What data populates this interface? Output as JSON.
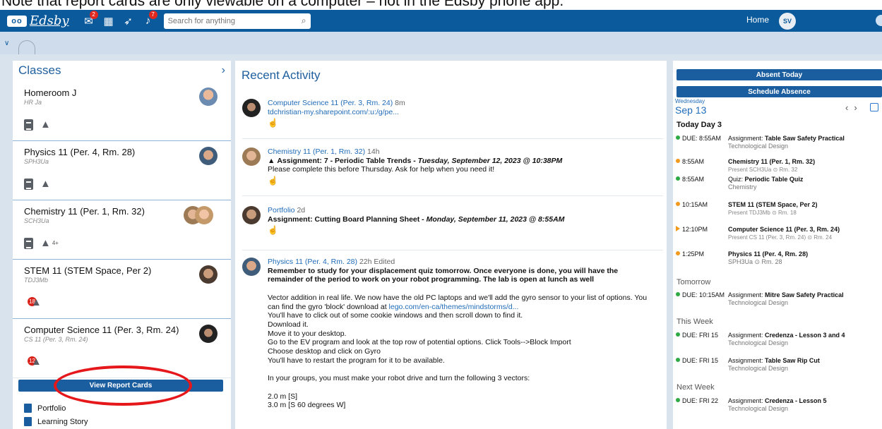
{
  "caption": "Note that report cards are only viewable on a computer – not in the Edsby phone app.",
  "colors": {
    "brand": "#0b5a9c",
    "accent_red": "#e5171a",
    "due_green": "#2eaa44",
    "event_orange": "#f39a1d"
  },
  "topbar": {
    "logo_mark": "oo",
    "logo_text": "Edsby",
    "mail_badge": "2",
    "bell_badge": "7",
    "search_placeholder": "Search for anything",
    "home": "Home",
    "avatar": "SV"
  },
  "classes": {
    "title": "Classes",
    "items": [
      {
        "name": "Homeroom J",
        "code": "HR Ja",
        "badge": "",
        "extra": ""
      },
      {
        "name": "Physics 11 (Per. 4, Rm. 28)",
        "code": "SPH3Ua",
        "badge": "",
        "extra": ""
      },
      {
        "name": "Chemistry 11 (Per. 1, Rm. 32)",
        "code": "SCH3Ua",
        "badge": "",
        "extra": "4+"
      },
      {
        "name": "STEM 11 (STEM Space, Per 2)",
        "code": "TDJ3Mb",
        "badge": "18",
        "extra": ""
      },
      {
        "name": "Computer Science 11 (Per. 3, Rm. 24)",
        "code": "CS 11 (Per. 3, Rm. 24)",
        "badge": "12",
        "extra": ""
      }
    ],
    "report_button": "View Report Cards",
    "links": [
      "Portfolio",
      "Learning Story"
    ]
  },
  "activity": {
    "title": "Recent Activity",
    "items": [
      {
        "source": "Computer Science 11 (Per. 3, Rm. 24)",
        "time": "8m",
        "link": "tdchristian-my.sharepoint.com/:u:/g/pe..."
      },
      {
        "source": "Chemistry 11 (Per. 1, Rm. 32)",
        "time": "14h",
        "label": "Assignment: 7 - Periodic Table Trends",
        "date": " - Tuesday, September 12, 2023 @ 10:38PM",
        "text": "Please complete this before Thursday. Ask for help when you need it!"
      },
      {
        "source": "Portfolio",
        "time": "2d",
        "label": "Assignment: Cutting Board Planning Sheet",
        "date": " - Monday, September 11, 2023 @ 8:55AM"
      },
      {
        "source": "Physics 11 (Per. 4, Rm. 28)",
        "time": "22h",
        "edited": "Edited",
        "bold1": "Remember to study for your displacement quiz tomorrow. Once everyone is done, you will have the",
        "bold2": "remainder of the period to work on your robot programming. The lab is open at lunch as well",
        "p1": "Vector addition in real life. We now have the old PC laptops and we'll add the gyro sensor to your list of options. You",
        "p2a": "can find the gyro 'block' download at ",
        "p2link": "lego.com/en-ca/themes/mindstorms/d...",
        "p3": "You'll have to click out of some cookie windows and then scroll down to find it.",
        "p4": "Download it.",
        "p5": "Move it to your desktop.",
        "p6": "Go to the EV program and look at the top row of potential options. Click Tools-->Block Import",
        "p7": "Choose desktop and click on Gyro",
        "p8": "You'll have to restart the program for it to be available.",
        "p9": "In your groups, you must make your robot drive and turn the following 3 vectors:",
        "p10": "2.0 m [S]",
        "p11": "3.0 m [S 60 degrees W]"
      }
    ]
  },
  "schedule": {
    "absent_today": "Absent Today",
    "schedule_absence": "Schedule Absence",
    "weekday": "Wednesday",
    "date": "Sep 13",
    "today_label": "Today  Day 3",
    "today_events": [
      {
        "time": "DUE: 8:55AM",
        "prefix": "Assignment: ",
        "title": "Table Saw Safety Practical",
        "sub": "Technological Design",
        "dot": "green"
      },
      {
        "time": "8:55AM",
        "prefix": "",
        "title": "Chemistry 11 (Per. 1, Rm. 32)",
        "sub": "Present SCH3Ua ⊙ Rm. 32",
        "dot": "orange"
      },
      {
        "time": "8:55AM",
        "prefix": "Quiz: ",
        "title": "Periodic Table Quiz",
        "sub": "Chemistry",
        "dot": "green"
      },
      {
        "time": "10:15AM",
        "prefix": "",
        "title": "STEM 11 (STEM Space, Per 2)",
        "sub": "Present TDJ3Mb ⊙ Rm. 18",
        "dot": "orange"
      },
      {
        "time": "12:10PM",
        "prefix": "",
        "title": "Computer Science 11 (Per. 3, Rm. 24)",
        "sub": "Present CS 11 (Per. 3, Rm. 24) ⊙ Rm. 24",
        "dot": "tri"
      },
      {
        "time": "1:25PM",
        "prefix": "",
        "title": "Physics 11 (Per. 4, Rm. 28)",
        "sub": "SPH3Ua ⊙ Rm. 28",
        "dot": "orange"
      }
    ],
    "tomorrow_label": "Tomorrow",
    "tomorrow_events": [
      {
        "time": "DUE: 10:15AM",
        "prefix": "Assignment: ",
        "title": "Mitre Saw Safety Practical",
        "sub": "Technological Design"
      }
    ],
    "week_label": "This Week",
    "week_events": [
      {
        "time": "DUE: FRI 15",
        "prefix": "Assignment: ",
        "title": "Credenza - Lesson 3 and 4",
        "sub": "Technological Design"
      },
      {
        "time": "DUE: FRI 15",
        "prefix": "Assignment: ",
        "title": "Table Saw Rip Cut",
        "sub": "Technological Design"
      }
    ],
    "next_label": "Next Week",
    "next_events": [
      {
        "time": "DUE: FRI 22",
        "prefix": "Assignment: ",
        "title": "Credenza - Lesson 5",
        "sub": "Technological Design"
      }
    ]
  }
}
